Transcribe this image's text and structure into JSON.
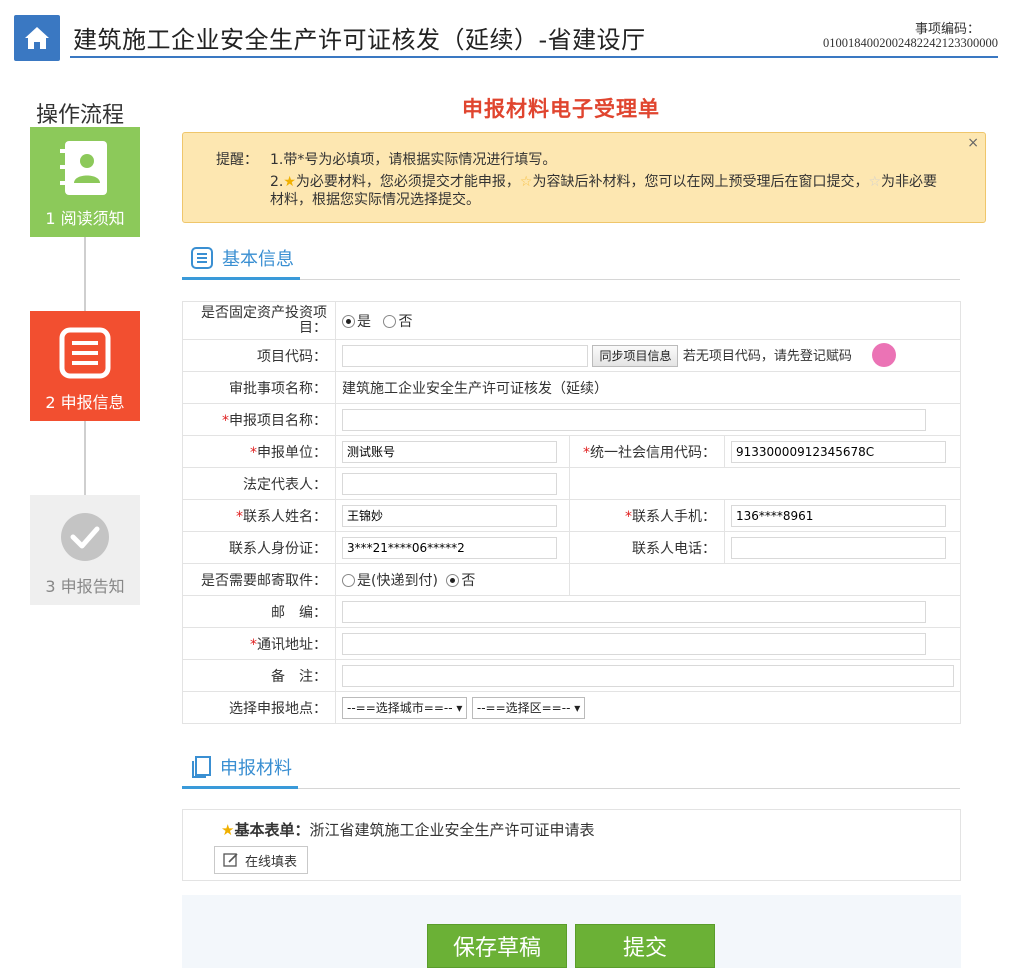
{
  "header": {
    "title": "建筑施工企业安全生产许可证核发（延续）-省建设厅",
    "code_label": "事项编码：",
    "code_value": "0100184002002482242123300000"
  },
  "sidebar": {
    "title": "操作流程",
    "steps": [
      {
        "label": "1 阅读须知",
        "icon": "contact-book-icon",
        "state": "done",
        "color": "#8cc95a"
      },
      {
        "label": "2 申报信息",
        "icon": "list-document-icon",
        "state": "current",
        "color": "#f24f30"
      },
      {
        "label": "3 申报告知",
        "icon": "check-circle-icon",
        "state": "pending",
        "color": "#efefef"
      }
    ]
  },
  "main": {
    "heading": "申报材料电子受理单",
    "notice": {
      "label": "提醒：",
      "line1": "1.带*号为必填项，请根据实际情况进行填写。",
      "line2_prefix": "2.",
      "line2_a": "为必要材料，您必须提交才能申报，",
      "line2_b": "为容缺后补材料，您可以在网上预受理后在窗口提交，",
      "line2_c": "为非必要材料，根据您实际情况选择提交。",
      "close": "×"
    },
    "basic_section": "基本信息",
    "materials_section": "申报材料"
  },
  "form": {
    "fixed_asset": {
      "label": "是否固定资产投资项目：",
      "opt_yes": "是",
      "opt_no": "否",
      "selected": "是"
    },
    "project_code": {
      "label": "项目代码：",
      "value": "",
      "sync_btn": "同步项目信息",
      "hint": "若无项目代码，请先登记赋码"
    },
    "approval_item": {
      "label": "审批事项名称：",
      "value": "建筑施工企业安全生产许可证核发（延续）"
    },
    "project_name": {
      "label": "申报项目名称：",
      "value": ""
    },
    "applicant": {
      "label": "申报单位：",
      "value": "测试账号"
    },
    "credit_code": {
      "label": "统一社会信用代码：",
      "value": "91330000912345678C"
    },
    "legal_rep": {
      "label": "法定代表人：",
      "value": ""
    },
    "contact_name": {
      "label": "联系人姓名：",
      "value": "王锦妙"
    },
    "contact_mobile": {
      "label": "联系人手机：",
      "value": "136****8961"
    },
    "contact_id": {
      "label": "联系人身份证：",
      "value": "3***21****06*****2"
    },
    "contact_phone": {
      "label": "联系人电话：",
      "value": ""
    },
    "mail_pickup": {
      "label": "是否需要邮寄取件：",
      "opt_yes": "是(快递到付)",
      "opt_no": "否",
      "selected": "否"
    },
    "postcode": {
      "label": "邮　编：",
      "value": ""
    },
    "address": {
      "label": "通讯地址：",
      "value": ""
    },
    "remark": {
      "label": "备　注：",
      "value": ""
    },
    "location": {
      "label": "选择申报地点：",
      "city": "--==选择城市==--",
      "district": "--==选择区==--"
    }
  },
  "materials": {
    "item_label": "基本表单：",
    "item_value": "浙江省建筑施工企业安全生产许可证申请表",
    "online_btn": "在线填表"
  },
  "actions": {
    "save": "保存草稿",
    "submit": "提交"
  }
}
